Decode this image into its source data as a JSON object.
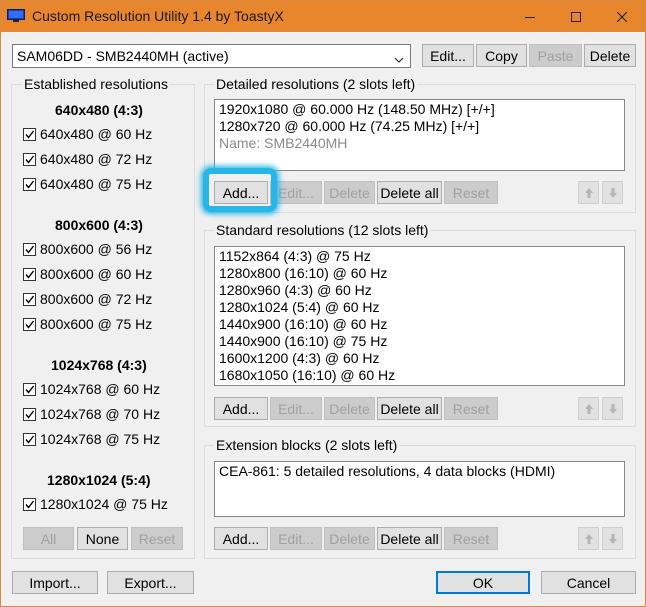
{
  "window": {
    "title": "Custom Resolution Utility 1.4 by ToastyX",
    "icons": {
      "app": "monitor-icon",
      "minimize": "minimize-icon",
      "maximize": "maximize-icon",
      "close": "close-icon"
    }
  },
  "monitor_select": {
    "value": "SAM06DD - SMB2440MH (active)"
  },
  "top_buttons": {
    "edit": "Edit...",
    "copy": "Copy",
    "paste": "Paste",
    "delete": "Delete"
  },
  "established": {
    "title": "Established resolutions",
    "groups": [
      {
        "heading": "640x480 (4:3)",
        "items": [
          "640x480 @ 60 Hz",
          "640x480 @ 72 Hz",
          "640x480 @ 75 Hz"
        ]
      },
      {
        "heading": "800x600 (4:3)",
        "items": [
          "800x600 @ 56 Hz",
          "800x600 @ 60 Hz",
          "800x600 @ 72 Hz",
          "800x600 @ 75 Hz"
        ]
      },
      {
        "heading": "1024x768 (4:3)",
        "items": [
          "1024x768 @ 60 Hz",
          "1024x768 @ 70 Hz",
          "1024x768 @ 75 Hz"
        ]
      },
      {
        "heading": "1280x1024 (5:4)",
        "items": [
          "1280x1024 @ 75 Hz"
        ]
      }
    ],
    "buttons": {
      "all": "All",
      "none": "None",
      "reset": "Reset"
    }
  },
  "detailed": {
    "title": "Detailed resolutions (2 slots left)",
    "items": [
      "1920x1080 @ 60.000 Hz (148.50 MHz) [+/+]",
      "1280x720 @ 60.000 Hz (74.25 MHz) [+/+]"
    ],
    "name_line": "Name: SMB2440MH",
    "buttons": {
      "add": "Add...",
      "edit": "Edit...",
      "delete": "Delete",
      "delete_all": "Delete all",
      "reset": "Reset"
    }
  },
  "standard": {
    "title": "Standard resolutions (12 slots left)",
    "items": [
      "1152x864 (4:3) @ 75 Hz",
      "1280x800 (16:10) @ 60 Hz",
      "1280x960 (4:3) @ 60 Hz",
      "1280x1024 (5:4) @ 60 Hz",
      "1440x900 (16:10) @ 60 Hz",
      "1440x900 (16:10) @ 75 Hz",
      "1600x1200 (4:3) @ 60 Hz",
      "1680x1050 (16:10) @ 60 Hz"
    ],
    "buttons": {
      "add": "Add...",
      "edit": "Edit...",
      "delete": "Delete",
      "delete_all": "Delete all",
      "reset": "Reset"
    }
  },
  "extension": {
    "title": "Extension blocks (2 slots left)",
    "items": [
      "CEA-861: 5 detailed resolutions, 4 data blocks (HDMI)"
    ],
    "buttons": {
      "add": "Add...",
      "edit": "Edit...",
      "delete": "Delete",
      "delete_all": "Delete all",
      "reset": "Reset"
    }
  },
  "footer": {
    "import": "Import...",
    "export": "Export...",
    "ok": "OK",
    "cancel": "Cancel"
  },
  "colors": {
    "titlebar": "#e8862e",
    "highlight": "#27b6e8"
  }
}
